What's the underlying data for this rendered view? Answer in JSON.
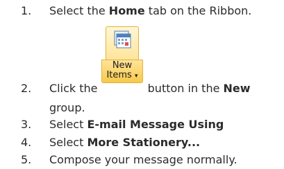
{
  "steps": [
    {
      "num": "1.",
      "pre": "Select the ",
      "bold": "Home",
      "post": " tab on the Ribbon."
    },
    {
      "num": "2.",
      "pre": "Click the ",
      "post_button": " button in the ",
      "bold": "New",
      "line2": "group."
    },
    {
      "num": "3.",
      "pre": "Select ",
      "bold": "E-mail Message Using"
    },
    {
      "num": "4.",
      "pre": "Select ",
      "bold": "More Stationery..."
    },
    {
      "num": "5.",
      "text": "Compose your message normally."
    }
  ],
  "button": {
    "label1": "New",
    "label2": "Items",
    "icon": "calendar-icon",
    "dropdown": "dropdown-arrow-icon"
  }
}
